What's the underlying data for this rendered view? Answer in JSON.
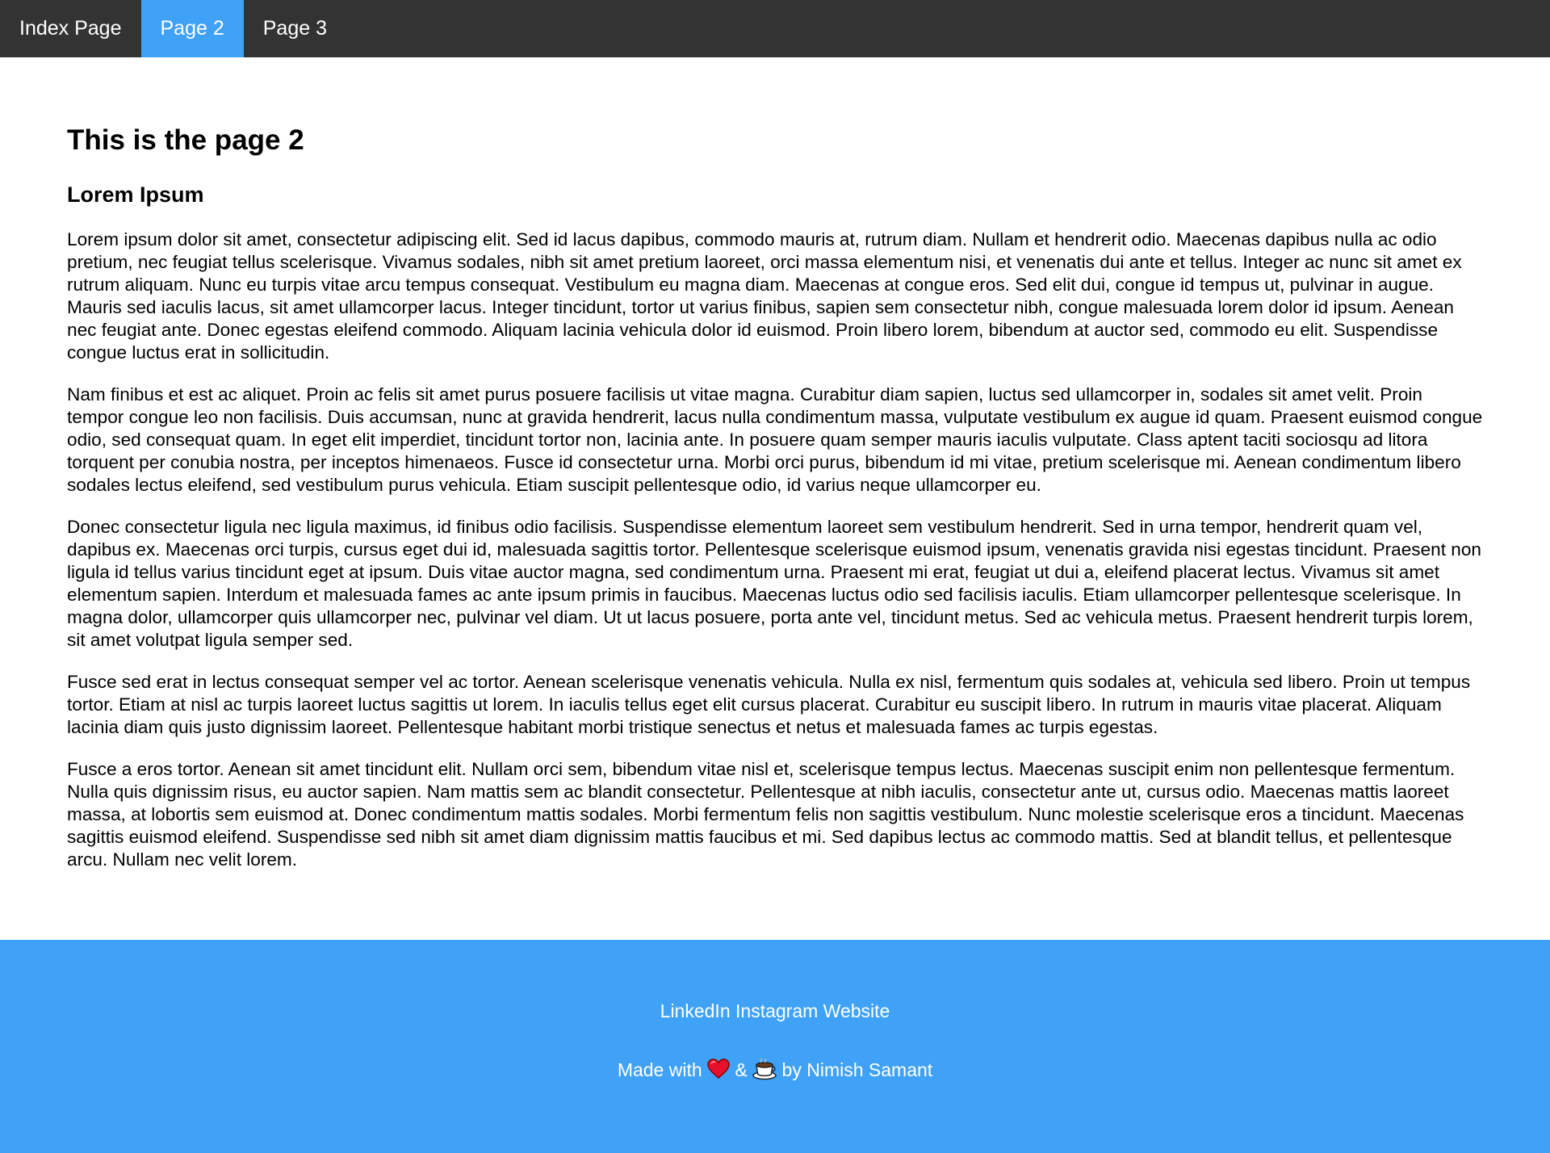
{
  "nav": {
    "items": [
      {
        "label": "Index Page",
        "active": false
      },
      {
        "label": "Page 2",
        "active": true
      },
      {
        "label": "Page 3",
        "active": false
      }
    ]
  },
  "main": {
    "title": "This is the page 2",
    "subtitle": "Lorem Ipsum",
    "paragraphs": [
      "Lorem ipsum dolor sit amet, consectetur adipiscing elit. Sed id lacus dapibus, commodo mauris at, rutrum diam. Nullam et hendrerit odio. Maecenas dapibus nulla ac odio pretium, nec feugiat tellus scelerisque. Vivamus sodales, nibh sit amet pretium laoreet, orci massa elementum nisi, et venenatis dui ante et tellus. Integer ac nunc sit amet ex rutrum aliquam. Nunc eu turpis vitae arcu tempus consequat. Vestibulum eu magna diam. Maecenas at congue eros. Sed elit dui, congue id tempus ut, pulvinar in augue. Mauris sed iaculis lacus, sit amet ullamcorper lacus. Integer tincidunt, tortor ut varius finibus, sapien sem consectetur nibh, congue malesuada lorem dolor id ipsum. Aenean nec feugiat ante. Donec egestas eleifend commodo. Aliquam lacinia vehicula dolor id euismod. Proin libero lorem, bibendum at auctor sed, commodo eu elit. Suspendisse congue luctus erat in sollicitudin.",
      "Nam finibus et est ac aliquet. Proin ac felis sit amet purus posuere facilisis ut vitae magna. Curabitur diam sapien, luctus sed ullamcorper in, sodales sit amet velit. Proin tempor congue leo non facilisis. Duis accumsan, nunc at gravida hendrerit, lacus nulla condimentum massa, vulputate vestibulum ex augue id quam. Praesent euismod congue odio, sed consequat quam. In eget elit imperdiet, tincidunt tortor non, lacinia ante. In posuere quam semper mauris iaculis vulputate. Class aptent taciti sociosqu ad litora torquent per conubia nostra, per inceptos himenaeos. Fusce id consectetur urna. Morbi orci purus, bibendum id mi vitae, pretium scelerisque mi. Aenean condimentum libero sodales lectus eleifend, sed vestibulum purus vehicula. Etiam suscipit pellentesque odio, id varius neque ullamcorper eu.",
      "Donec consectetur ligula nec ligula maximus, id finibus odio facilisis. Suspendisse elementum laoreet sem vestibulum hendrerit. Sed in urna tempor, hendrerit quam vel, dapibus ex. Maecenas orci turpis, cursus eget dui id, malesuada sagittis tortor. Pellentesque scelerisque euismod ipsum, venenatis gravida nisi egestas tincidunt. Praesent non ligula id tellus varius tincidunt eget at ipsum. Duis vitae auctor magna, sed condimentum urna. Praesent mi erat, feugiat ut dui a, eleifend placerat lectus. Vivamus sit amet elementum sapien. Interdum et malesuada fames ac ante ipsum primis in faucibus. Maecenas luctus odio sed facilisis iaculis. Etiam ullamcorper pellentesque scelerisque. In magna dolor, ullamcorper quis ullamcorper nec, pulvinar vel diam. Ut ut lacus posuere, porta ante vel, tincidunt metus. Sed ac vehicula metus. Praesent hendrerit turpis lorem, sit amet volutpat ligula semper sed.",
      "Fusce sed erat in lectus consequat semper vel ac tortor. Aenean scelerisque venenatis vehicula. Nulla ex nisl, fermentum quis sodales at, vehicula sed libero. Proin ut tempus tortor. Etiam at nisl ac turpis laoreet luctus sagittis ut lorem. In iaculis tellus eget elit cursus placerat. Curabitur eu suscipit libero. In rutrum in mauris vitae placerat. Aliquam lacinia diam quis justo dignissim laoreet. Pellentesque habitant morbi tristique senectus et netus et malesuada fames ac turpis egestas.",
      "Fusce a eros tortor. Aenean sit amet tincidunt elit. Nullam orci sem, bibendum vitae nisl et, scelerisque tempus lectus. Maecenas suscipit enim non pellentesque fermentum. Nulla quis dignissim risus, eu auctor sapien. Nam mattis sem ac blandit consectetur. Pellentesque at nibh iaculis, consectetur ante ut, cursus odio. Maecenas mattis laoreet massa, at lobortis sem euismod at. Donec condimentum mattis sodales. Morbi fermentum felis non sagittis vestibulum. Nunc molestie scelerisque eros a tincidunt. Maecenas sagittis euismod eleifend. Suspendisse sed nibh sit amet diam dignissim mattis faucibus et mi. Sed dapibus lectus ac commodo mattis. Sed at blandit tellus, et pellentesque arcu. Nullam nec velit lorem."
    ]
  },
  "footer": {
    "links": [
      "LinkedIn",
      "Instagram",
      "Website"
    ],
    "made_prefix": "Made with",
    "made_amp": "&",
    "made_suffix": "by Nimish Samant",
    "icons": [
      "heart-icon",
      "coffee-icon"
    ]
  },
  "colors": {
    "nav_bg": "#333333",
    "accent": "#3fa2f6",
    "text": "#000000",
    "footer_text": "#ffffff"
  }
}
